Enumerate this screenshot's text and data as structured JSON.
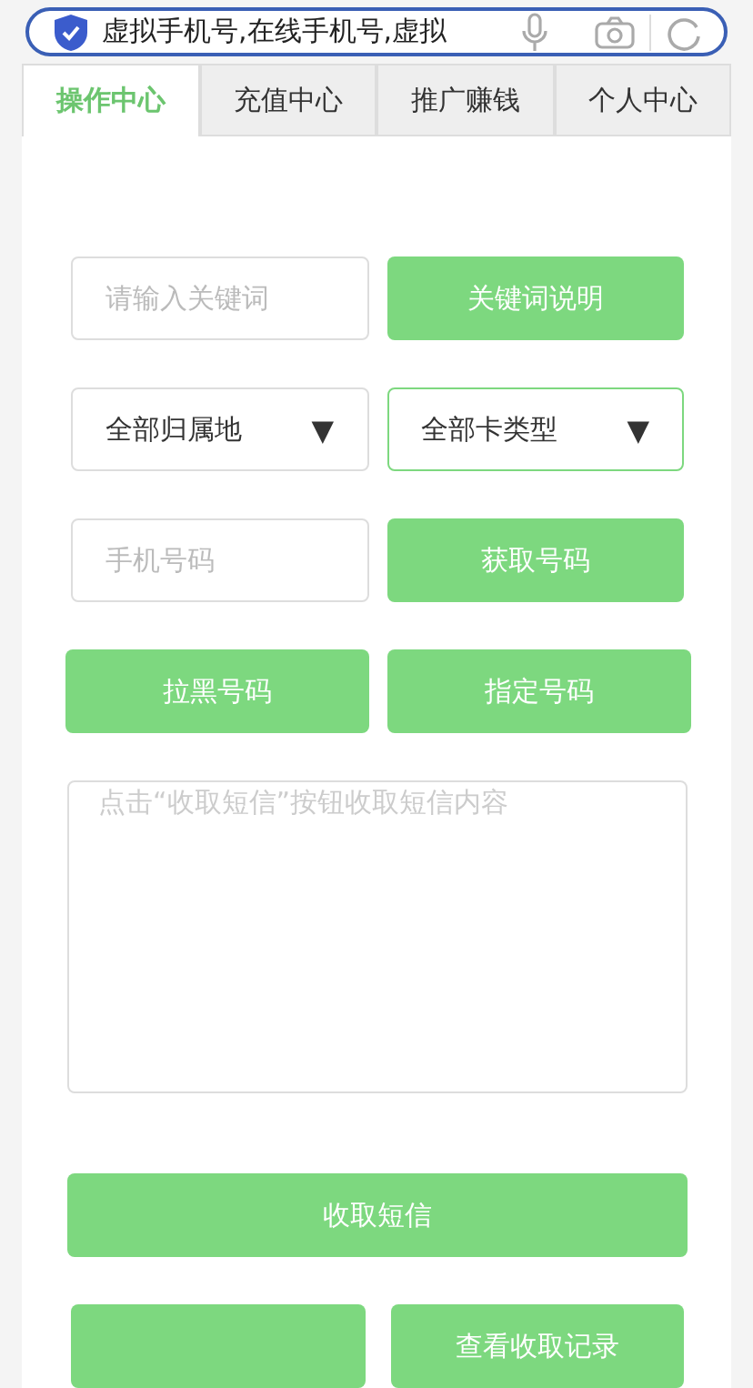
{
  "search_bar": {
    "value": "虚拟手机号,在线手机号,虚拟"
  },
  "tabs": [
    {
      "label": "操作中心",
      "selected": true
    },
    {
      "label": "充值中心",
      "selected": false
    },
    {
      "label": "推广赚钱",
      "selected": false
    },
    {
      "label": "个人中心",
      "selected": false
    }
  ],
  "keyword": {
    "placeholder": "请输入关键词",
    "button": "关键词说明"
  },
  "filters": [
    {
      "label": "全部归属地",
      "arrow": "▼",
      "selected": false
    },
    {
      "label": "全部卡类型",
      "arrow": "▼",
      "selected": true
    }
  ],
  "phone": {
    "placeholder": "手机号码",
    "button": "获取号码"
  },
  "actions": [
    "拉黑号码",
    "指定号码"
  ],
  "sms_box": {
    "placeholder": "点击“收取短信”按钮收取短信内容"
  },
  "receive_button": "收取短信",
  "bottom_buttons": [
    {
      "kind": "covered"
    },
    {
      "kind": "labelled",
      "label": "查看收取记录"
    }
  ]
}
